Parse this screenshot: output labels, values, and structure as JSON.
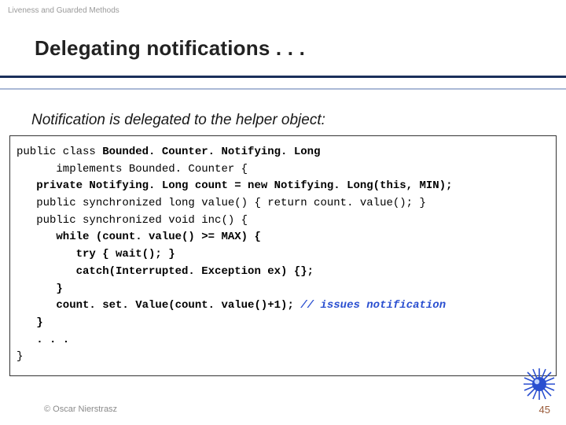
{
  "breadcrumb": "Liveness and Guarded Methods",
  "title": "Delegating notifications . . .",
  "subtitle": "Notification is delegated to the helper object:",
  "code": {
    "l01": "public class ",
    "l01b": "Bounded. Counter. Notifying. Long",
    "l02": "      implements Bounded. Counter {",
    "l03": "   private Notifying. Long count = new Notifying. Long(this, MIN);",
    "l04": "   public synchronized long value() { return count. value(); }",
    "l05": "   public synchronized void inc() {",
    "l06": "      while (count. value() >= MAX) {",
    "l07": "         try { wait(); }",
    "l08": "         catch(Interrupted. Exception ex) {};",
    "l09": "      }",
    "l10": "      count. set. Value(count. value()+1); ",
    "l10c": "// issues notification",
    "l11": "   }",
    "l12": "   . . .",
    "l13": "}"
  },
  "footer": {
    "copyright": "© Oscar Nierstrasz",
    "page": "45"
  },
  "icons": {
    "sun": "sun-icon"
  }
}
